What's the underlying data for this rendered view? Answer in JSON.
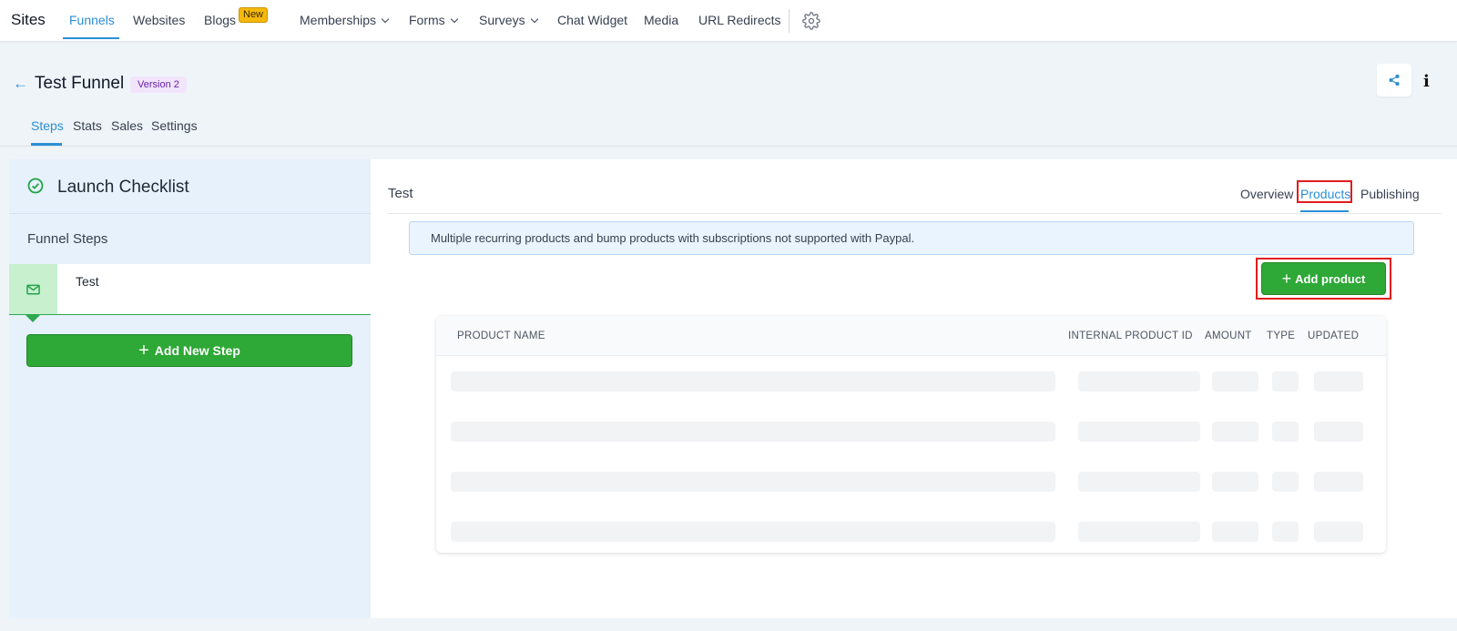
{
  "topnav": {
    "brand": "Sites",
    "items": [
      {
        "label": "Funnels",
        "active": true
      },
      {
        "label": "Websites"
      },
      {
        "label": "Blogs",
        "badge": "New"
      },
      {
        "label": "Memberships",
        "dropdown": true
      },
      {
        "label": "Forms",
        "dropdown": true
      },
      {
        "label": "Surveys",
        "dropdown": true
      },
      {
        "label": "Chat Widget"
      },
      {
        "label": "Media"
      },
      {
        "label": "URL Redirects"
      }
    ],
    "settings_icon": "gear-icon"
  },
  "header": {
    "back_icon": "←",
    "title": "Test Funnel",
    "version": "Version 2",
    "share_icon": "share-icon",
    "info_icon": "i",
    "tabs": [
      {
        "label": "Steps",
        "active": true
      },
      {
        "label": "Stats"
      },
      {
        "label": "Sales"
      },
      {
        "label": "Settings"
      }
    ]
  },
  "sidebar": {
    "checklist_title": "Launch Checklist",
    "funnel_steps_label": "Funnel Steps",
    "steps": [
      {
        "label": "Test",
        "icon": "mail-icon"
      }
    ],
    "add_step_label": "Add New Step"
  },
  "main": {
    "title": "Test",
    "tabs": [
      {
        "label": "Overview"
      },
      {
        "label": "Products",
        "active": true
      },
      {
        "label": "Publishing"
      }
    ],
    "alert": "Multiple recurring products and bump products with subscriptions not supported with Paypal.",
    "add_product_label": "Add product",
    "table": {
      "columns": [
        "PRODUCT NAME",
        "INTERNAL PRODUCT ID",
        "AMOUNT",
        "TYPE",
        "UPDATED"
      ],
      "loading_rows": 4
    }
  },
  "colors": {
    "accent": "#2b8fd6",
    "primary_button": "#2ea836",
    "highlight": "#e11d1d",
    "version_badge_bg": "#f1e4fb",
    "new_badge": "#f5b80b"
  }
}
